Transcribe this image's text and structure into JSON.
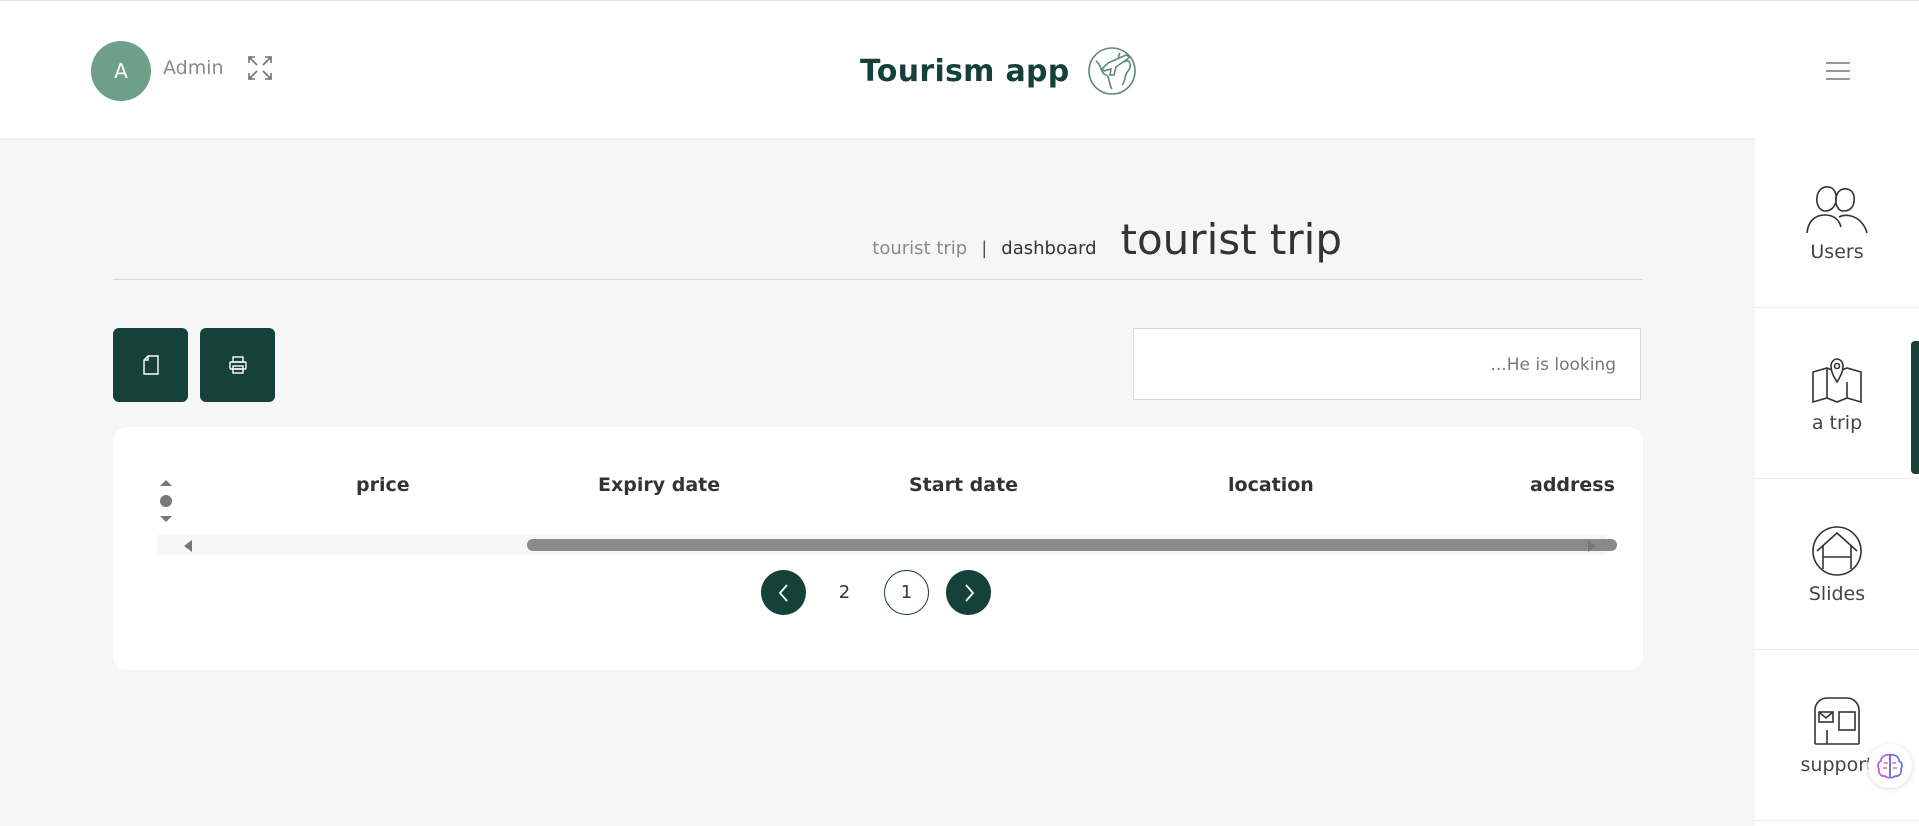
{
  "header": {
    "avatar_letter": "A",
    "user_name": "Admin",
    "app_title": "Tourism app"
  },
  "page": {
    "breadcrumb_current": "tourist trip",
    "breadcrumb_separator": "|",
    "breadcrumb_link": "dashboard",
    "title": "tourist trip"
  },
  "search": {
    "placeholder": "...He is looking"
  },
  "table": {
    "columns": [
      "price",
      "Expiry date",
      "Start date",
      "location",
      "address"
    ]
  },
  "pagination": {
    "pages": [
      "2",
      "1"
    ]
  },
  "sidebar": {
    "items": [
      {
        "label": "Users",
        "icon": "users-icon"
      },
      {
        "label": "a trip",
        "icon": "map-icon"
      },
      {
        "label": "Slides",
        "icon": "slides-icon"
      },
      {
        "label": "support",
        "icon": "mailbox-icon"
      }
    ]
  },
  "colors": {
    "primary": "#16413a",
    "avatar": "#6e9f8a",
    "background": "#f6f6f6"
  }
}
